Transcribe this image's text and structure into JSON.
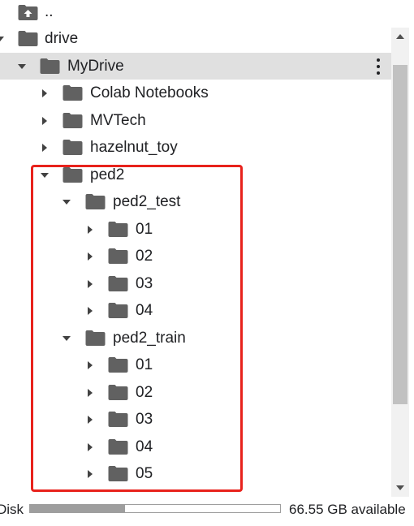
{
  "tree": {
    "rows": [
      {
        "label": "..",
        "icon": "folder-up-icon",
        "caret": "none"
      },
      {
        "label": "drive",
        "icon": "folder-icon",
        "caret": "down"
      },
      {
        "label": "MyDrive",
        "icon": "folder-icon",
        "caret": "down",
        "selected": true
      },
      {
        "label": "Colab Notebooks",
        "icon": "folder-icon",
        "caret": "right"
      },
      {
        "label": "MVTech",
        "icon": "folder-icon",
        "caret": "right"
      },
      {
        "label": "hazelnut_toy",
        "icon": "folder-icon",
        "caret": "right"
      },
      {
        "label": "ped2",
        "icon": "folder-icon",
        "caret": "down"
      },
      {
        "label": "ped2_test",
        "icon": "folder-icon",
        "caret": "down"
      },
      {
        "label": "01",
        "icon": "folder-icon",
        "caret": "right"
      },
      {
        "label": "02",
        "icon": "folder-icon",
        "caret": "right"
      },
      {
        "label": "03",
        "icon": "folder-icon",
        "caret": "right"
      },
      {
        "label": "04",
        "icon": "folder-icon",
        "caret": "right"
      },
      {
        "label": "ped2_train",
        "icon": "folder-icon",
        "caret": "down"
      },
      {
        "label": "01",
        "icon": "folder-icon",
        "caret": "right"
      },
      {
        "label": "02",
        "icon": "folder-icon",
        "caret": "right"
      },
      {
        "label": "03",
        "icon": "folder-icon",
        "caret": "right"
      },
      {
        "label": "04",
        "icon": "folder-icon",
        "caret": "right"
      },
      {
        "label": "05",
        "icon": "folder-icon",
        "caret": "right"
      }
    ]
  },
  "footer": {
    "disk_label": "Disk",
    "disk_usage_fraction": 0.38,
    "available": "66.55 GB available"
  },
  "colors": {
    "folder": "#616161",
    "selected_row": "#e0e0e0",
    "highlight_box": "#e8221c"
  }
}
